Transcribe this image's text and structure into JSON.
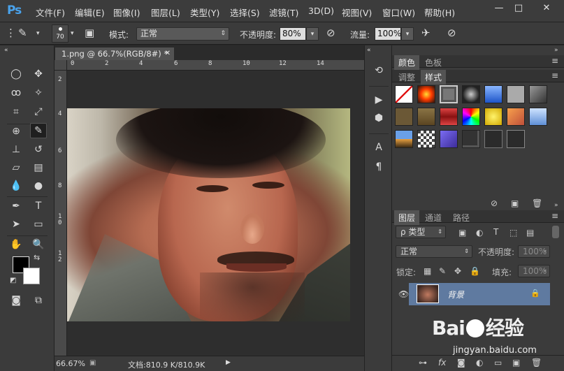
{
  "app": {
    "logo": "Ps",
    "menu": [
      "文件(F)",
      "编辑(E)",
      "图像(I)",
      "图层(L)",
      "类型(Y)",
      "选择(S)",
      "滤镜(T)",
      "3D(D)",
      "视图(V)",
      "窗口(W)",
      "帮助(H)"
    ],
    "window_controls": {
      "minimize": "—",
      "maximize": "□",
      "close": "✕"
    }
  },
  "options": {
    "brush_size": "70",
    "mode_label": "模式:",
    "mode_value": "正常",
    "opacity_label": "不透明度:",
    "opacity_value": "80%",
    "flow_label": "流量:",
    "flow_value": "100%"
  },
  "document": {
    "tab_title": "1.png @ 66.7%(RGB/8#) *",
    "ruler_top": [
      "0",
      "2",
      "4",
      "6",
      "8",
      "10",
      "12",
      "14"
    ],
    "ruler_left": [
      "2",
      "4",
      "6",
      "8",
      "1\n0",
      "1\n2"
    ],
    "zoom": "66.67%",
    "doc_size": "文档:810.9 K/810.9K"
  },
  "panels": {
    "color_tabs": [
      "颜色",
      "色板"
    ],
    "style_tabs": [
      "调整",
      "样式"
    ],
    "layer_tabs": [
      "图层",
      "通道",
      "路径"
    ],
    "filter_label": "ρ 类型",
    "blend_mode": "正常",
    "opacity_label": "不透明度:",
    "opacity_value": "100%",
    "lock_label": "锁定:",
    "fill_label": "填充:",
    "fill_value": "100%",
    "layer_name": "背景"
  },
  "watermark": {
    "logo_text_a": "Bai",
    "logo_text_b": "经验",
    "url": "jingyan.baidu.com"
  }
}
